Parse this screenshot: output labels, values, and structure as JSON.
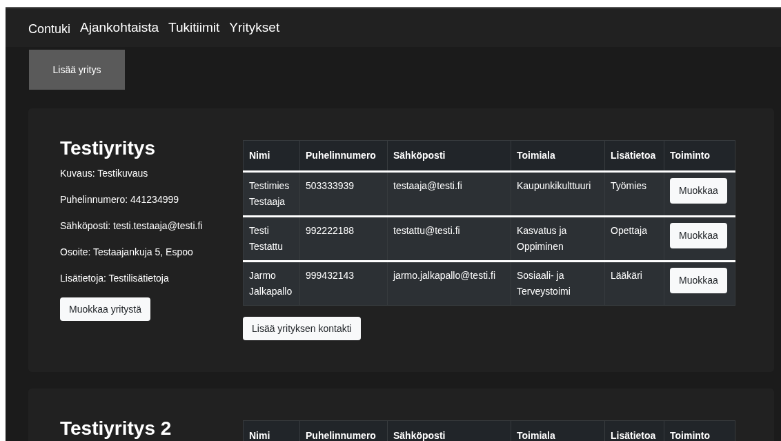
{
  "nav": {
    "brand": "Contuki",
    "links": [
      "Ajankohtaista",
      "Tukitiimit",
      "Yritykset"
    ]
  },
  "add_company_button": "Lisää yritys",
  "companies": [
    {
      "name": "Testiyritys",
      "details": [
        "Kuvaus: Testikuvaus",
        "Puhelinnumero: 441234999",
        "Sähköposti: testi.testaaja@testi.fi",
        "Osoite: Testaajankuja 5, Espoo",
        "Lisätietoja: Testilisätietoja"
      ],
      "edit_button": "Muokkaa yritystä",
      "table": {
        "columns": [
          "Nimi",
          "Puhelinnumero",
          "Sähköposti",
          "Toimiala",
          "Lisätietoa",
          "Toiminto"
        ],
        "rows": [
          {
            "cells": [
              "Testimies Testaaja",
              "503333939",
              "testaaja@testi.fi",
              "Kaupunkikulttuuri",
              "Työmies"
            ],
            "action": "Muokkaa"
          },
          {
            "cells": [
              "Testi Testattu",
              "992222188",
              "testattu@testi.fi",
              "Kasvatus ja Oppiminen",
              "Opettaja"
            ],
            "action": "Muokkaa"
          },
          {
            "cells": [
              "Jarmo Jalkapallo",
              "999432143",
              "jarmo.jalkapallo@testi.fi",
              "Sosiaali- ja Terveystoimi",
              "Lääkäri"
            ],
            "action": "Muokkaa"
          }
        ]
      },
      "add_contact_button": "Lisää yrityksen kontakti"
    },
    {
      "name": "Testiyritys 2",
      "table": {
        "columns": [
          "Nimi",
          "Puhelinnumero",
          "Sähköposti",
          "Toimiala",
          "Lisätietoa",
          "Toiminto"
        ]
      }
    }
  ]
}
